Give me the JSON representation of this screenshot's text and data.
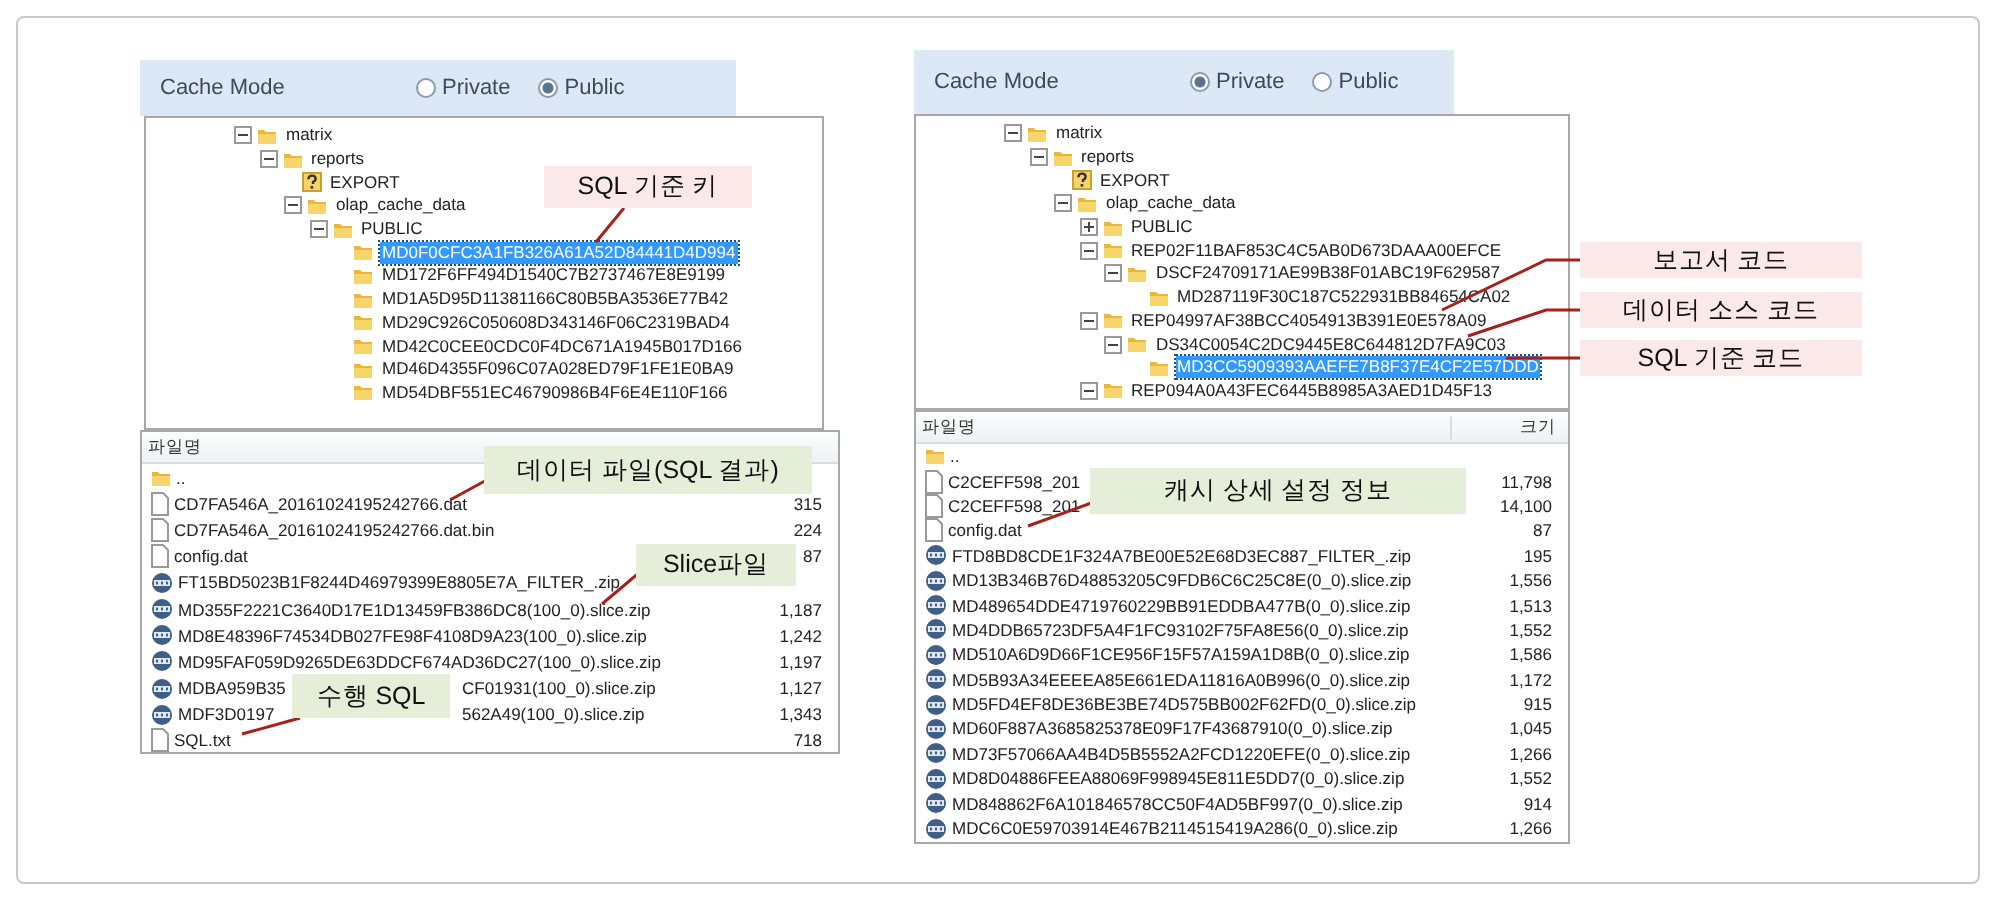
{
  "left_panel": {
    "cache_mode": {
      "label": "Cache Mode",
      "options": [
        {
          "label": "Private",
          "selected": false
        },
        {
          "label": "Public",
          "selected": true
        }
      ]
    },
    "tree": [
      {
        "label": "matrix",
        "kind": "folder",
        "expanded": true,
        "selected": false,
        "children": [
          {
            "label": "reports",
            "kind": "folder",
            "expanded": true,
            "selected": false,
            "children": [
              {
                "label": "EXPORT",
                "kind": "unknown",
                "selected": false
              },
              {
                "label": "olap_cache_data",
                "kind": "folder",
                "expanded": true,
                "selected": false,
                "children": [
                  {
                    "label": "PUBLIC",
                    "kind": "folder",
                    "expanded": true,
                    "selected": false,
                    "children": [
                      {
                        "label": "MD0F0CFC3A1FB326A61A52D84441D4D994",
                        "kind": "folder",
                        "selected": true
                      },
                      {
                        "label": "MD172F6FF494D1540C7B2737467E8E9199",
                        "kind": "folder",
                        "selected": false
                      },
                      {
                        "label": "MD1A5D95D11381166C80B5BA3536E77B42",
                        "kind": "folder",
                        "selected": false
                      },
                      {
                        "label": "MD29C926C050608D343146F06C2319BAD4",
                        "kind": "folder",
                        "selected": false
                      },
                      {
                        "label": "MD42C0CEE0CDC0F4DC671A1945B017D166",
                        "kind": "folder",
                        "selected": false
                      },
                      {
                        "label": "MD46D4355F096C07A028ED79F1FE1E0BA9",
                        "kind": "folder",
                        "selected": false
                      },
                      {
                        "label": "MD54DBF551EC46790986B4F6E4E110F166",
                        "kind": "folder",
                        "selected": false
                      }
                    ]
                  }
                ]
              }
            ]
          }
        ]
      }
    ],
    "file_list": {
      "columns": [
        "파일명"
      ],
      "files": [
        {
          "kind": "folder",
          "name": ".."
        },
        {
          "kind": "file",
          "name": "CD7FA546A_20161024195242766.dat",
          "size": "315"
        },
        {
          "kind": "file",
          "name": "CD7FA546A_20161024195242766.dat.bin",
          "size": "224"
        },
        {
          "kind": "file",
          "name": "config.dat",
          "size": "87"
        },
        {
          "kind": "zip",
          "name": "FT15BD5023B1F8244D46979399E8805E7A_FILTER_.zip"
        },
        {
          "kind": "zip",
          "name": "MD355F2221C3640D17E1D13459FB386DC8(100_0).slice.zip",
          "size": "1,187"
        },
        {
          "kind": "zip",
          "name": "MD8E48396F74534DB027FE98F4108D9A23(100_0).slice.zip",
          "size": "1,242"
        },
        {
          "kind": "zip",
          "name": "MD95FAF059D9265DE63DDCF674AD36DC27(100_0).slice.zip",
          "size": "1,197"
        },
        {
          "kind": "zip",
          "name": "MDBA959B35",
          "name_tail": "CF01931(100_0).slice.zip",
          "size": "1,127"
        },
        {
          "kind": "zip",
          "name": "MDF3D0197",
          "name_tail": "562A49(100_0).slice.zip",
          "size": "1,343"
        },
        {
          "kind": "file",
          "name": "SQL.txt",
          "size": "718"
        }
      ]
    },
    "callouts": [
      {
        "text": "SQL 기준 키",
        "color": "#fbe9e9"
      },
      {
        "text": "데이터 파일(SQL 결과)",
        "color": "#e4eed8"
      },
      {
        "text": "Slice파일",
        "color": "#e4eed8"
      },
      {
        "text": "수행 SQL",
        "color": "#e4eed8"
      }
    ]
  },
  "right_panel": {
    "cache_mode": {
      "label": "Cache Mode",
      "options": [
        {
          "label": "Private",
          "selected": true
        },
        {
          "label": "Public",
          "selected": false
        }
      ]
    },
    "tree": [
      {
        "label": "matrix",
        "kind": "folder",
        "expanded": true,
        "selected": false,
        "children": [
          {
            "label": "reports",
            "kind": "folder",
            "expanded": true,
            "selected": false,
            "children": [
              {
                "label": "EXPORT",
                "kind": "unknown",
                "selected": false
              },
              {
                "label": "olap_cache_data",
                "kind": "folder",
                "expanded": true,
                "selected": false,
                "children": [
                  {
                    "label": "PUBLIC",
                    "kind": "folder",
                    "expanded": false,
                    "selected": false
                  },
                  {
                    "label": "REP02F11BAF853C4C5AB0D673DAAA00EFCE",
                    "kind": "folder",
                    "expanded": true,
                    "selected": false,
                    "children": [
                      {
                        "label": "DSCF24709171AE99B38F01ABC19F629587",
                        "kind": "folder",
                        "expanded": true,
                        "selected": false,
                        "children": [
                          {
                            "label": "MD287119F30C187C522931BB84654CA02",
                            "kind": "folder",
                            "selected": false
                          }
                        ]
                      }
                    ]
                  },
                  {
                    "label": "REP04997AF38BCC4054913B391E0E578A09",
                    "kind": "folder",
                    "expanded": true,
                    "selected": false,
                    "children": [
                      {
                        "label": "DS34C0054C2DC9445E8C644812D7FA9C03",
                        "kind": "folder",
                        "expanded": true,
                        "selected": false,
                        "children": [
                          {
                            "label": "MD3CC5909393AAEFE7B8F37E4CF2E57DDD",
                            "kind": "folder",
                            "selected": true
                          }
                        ]
                      }
                    ]
                  },
                  {
                    "label": "REP094A0A43FEC6445B8985A3AED1D45F13",
                    "kind": "folder",
                    "expanded": true,
                    "selected": false
                  }
                ]
              }
            ]
          }
        ]
      }
    ],
    "file_list": {
      "columns": [
        "파일명",
        "크기"
      ],
      "files": [
        {
          "kind": "folder",
          "name": ".."
        },
        {
          "kind": "file",
          "name": "C2CEFF598_201",
          "size": "11,798"
        },
        {
          "kind": "file",
          "name": "C2CEFF598_201",
          "size": "14,100"
        },
        {
          "kind": "file",
          "name": "config.dat",
          "size": "87"
        },
        {
          "kind": "zip",
          "name": "FTD8BD8CDE1F324A7BE00E52E68D3EC887_FILTER_.zip",
          "size": "195"
        },
        {
          "kind": "zip",
          "name": "MD13B346B76D48853205C9FDB6C6C25C8E(0_0).slice.zip",
          "size": "1,556"
        },
        {
          "kind": "zip",
          "name": "MD489654DDE4719760229BB91EDDBA477B(0_0).slice.zip",
          "size": "1,513"
        },
        {
          "kind": "zip",
          "name": "MD4DDB65723DF5A4F1FC93102F75FA8E56(0_0).slice.zip",
          "size": "1,552"
        },
        {
          "kind": "zip",
          "name": "MD510A6D9D66F1CE956F15F57A159A1D8B(0_0).slice.zip",
          "size": "1,586"
        },
        {
          "kind": "zip",
          "name": "MD5B93A34EEEEA85E661EDA11816A0B996(0_0).slice.zip",
          "size": "1,172"
        },
        {
          "kind": "zip",
          "name": "MD5FD4EF8DE36BE3BE74D575BB002F62FD(0_0).slice.zip",
          "size": "915"
        },
        {
          "kind": "zip",
          "name": "MD60F887A3685825378E09F17F43687910(0_0).slice.zip",
          "size": "1,045"
        },
        {
          "kind": "zip",
          "name": "MD73F57066AA4B4D5B5552A2FCD1220EFE(0_0).slice.zip",
          "size": "1,266"
        },
        {
          "kind": "zip",
          "name": "MD8D04886FEEA88069F998945E811E5DD7(0_0).slice.zip",
          "size": "1,552"
        },
        {
          "kind": "zip",
          "name": "MD848862F6A101846578CC50F4AD5BF997(0_0).slice.zip",
          "size": "914"
        },
        {
          "kind": "zip",
          "name": "MDC6C0E59703914E467B2114515419A286(0_0).slice.zip",
          "size": "1,266"
        }
      ]
    },
    "callouts": [
      {
        "text": "보고서 코드",
        "color": "#fbe9e9"
      },
      {
        "text": "데이터 소스 코드",
        "color": "#fbe9e9"
      },
      {
        "text": "SQL 기준 코드",
        "color": "#fbe9e9"
      },
      {
        "text": "캐시 상세 설정 정보",
        "color": "#e4eed8"
      }
    ]
  }
}
